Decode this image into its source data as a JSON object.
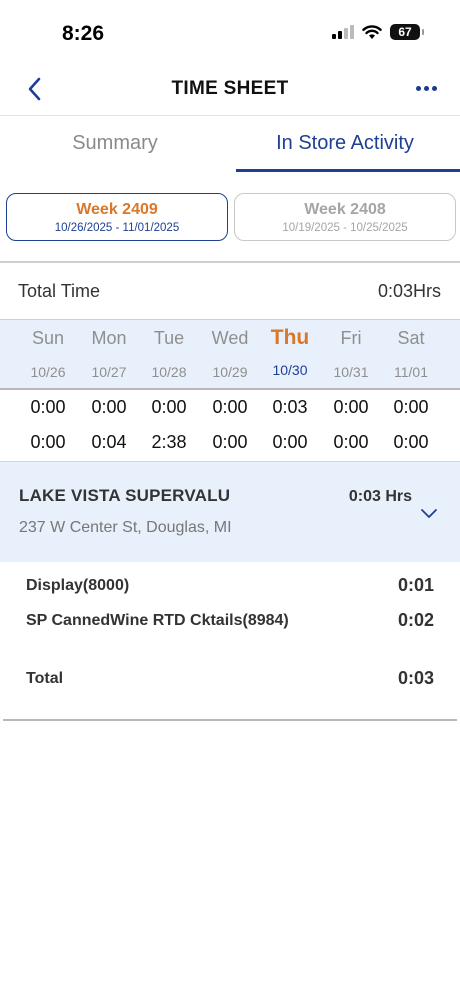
{
  "status_bar": {
    "time": "8:26",
    "battery": "67"
  },
  "nav": {
    "title": "TIME SHEET"
  },
  "tabs": [
    {
      "label": "Summary",
      "active": false
    },
    {
      "label": "In Store Activity",
      "active": true
    }
  ],
  "weeks": [
    {
      "label": "Week 2409",
      "range": "10/26/2025 - 11/01/2025",
      "selected": true
    },
    {
      "label": "Week 2408",
      "range": "10/19/2025 - 10/25/2025",
      "selected": false
    }
  ],
  "total_time": {
    "label": "Total Time",
    "value": "0:03Hrs"
  },
  "days": [
    {
      "name": "Sun",
      "date": "10/26"
    },
    {
      "name": "Mon",
      "date": "10/27"
    },
    {
      "name": "Tue",
      "date": "10/28"
    },
    {
      "name": "Wed",
      "date": "10/29"
    },
    {
      "name": "Thu",
      "date": "10/30",
      "today": true
    },
    {
      "name": "Fri",
      "date": "10/31"
    },
    {
      "name": "Sat",
      "date": "11/01"
    }
  ],
  "time_rows": [
    [
      "0:00",
      "0:00",
      "0:00",
      "0:00",
      "0:03",
      "0:00",
      "0:00"
    ],
    [
      "0:00",
      "0:04",
      "2:38",
      "0:00",
      "0:00",
      "0:00",
      "0:00"
    ]
  ],
  "store": {
    "name": "LAKE VISTA SUPERVALU",
    "hours": "0:03 Hrs",
    "address": "237 W Center St, Douglas, MI"
  },
  "activities": [
    {
      "label": "Display(8000)",
      "value": "0:01"
    },
    {
      "label": "SP CannedWine RTD Cktails(8984)",
      "value": "0:02"
    },
    {
      "label": "Total",
      "value": "0:03"
    }
  ],
  "colors": {
    "accent_blue": "#1e3f94",
    "accent_orange": "#d9782a",
    "highlight_bg": "#e8f0fb"
  }
}
